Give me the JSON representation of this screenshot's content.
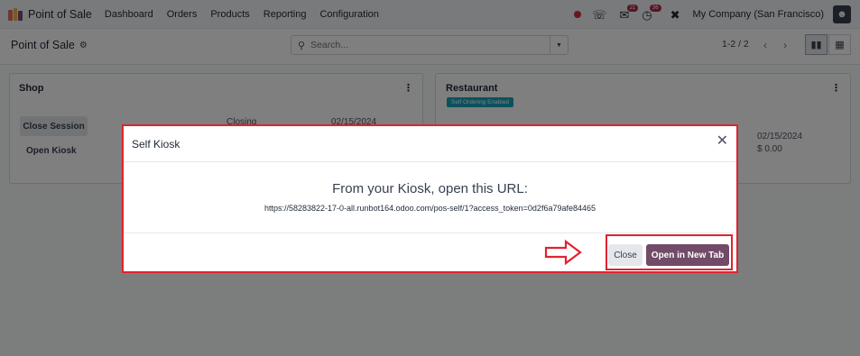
{
  "navbar": {
    "app_name": "Point of Sale",
    "menu": [
      "Dashboard",
      "Orders",
      "Products",
      "Reporting",
      "Configuration"
    ],
    "messages_badge": "21",
    "activities_badge": "36",
    "company": "My Company (San Francisco)"
  },
  "control_panel": {
    "breadcrumb": "Point of Sale",
    "search_placeholder": "Search...",
    "pager": "1-2 / 2"
  },
  "shop_card": {
    "title": "Shop",
    "close_session_label": "Close Session",
    "open_kiosk_label": "Open Kiosk",
    "closing_label": "Closing",
    "closing_date": "02/15/2024"
  },
  "restaurant_card": {
    "title": "Restaurant",
    "badge": "Self Ordering Enabled",
    "date": "02/15/2024",
    "amount": "$ 0.00"
  },
  "modal": {
    "title": "Self Kiosk",
    "heading": "From your Kiosk, open this URL:",
    "url": "https://58283822-17-0-all.runbot164.odoo.com/pos-self/1?access_token=0d2f6a79afe84465",
    "close_label": "Close",
    "open_label": "Open in New Tab"
  },
  "colors": {
    "primary": "#714b67",
    "highlight": "#e0232e",
    "badge": "#17a2b8"
  }
}
